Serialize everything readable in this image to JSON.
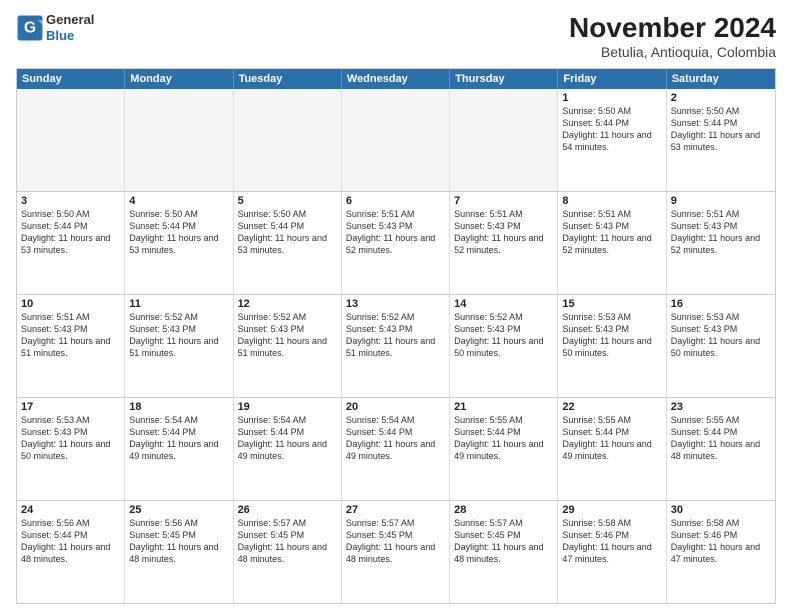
{
  "logo": {
    "general": "General",
    "blue": "Blue"
  },
  "title": "November 2024",
  "subtitle": "Betulia, Antioquia, Colombia",
  "weekdays": [
    "Sunday",
    "Monday",
    "Tuesday",
    "Wednesday",
    "Thursday",
    "Friday",
    "Saturday"
  ],
  "weeks": [
    [
      {
        "day": "",
        "empty": true
      },
      {
        "day": "",
        "empty": true
      },
      {
        "day": "",
        "empty": true
      },
      {
        "day": "",
        "empty": true
      },
      {
        "day": "",
        "empty": true
      },
      {
        "day": "1",
        "sunrise": "5:50 AM",
        "sunset": "5:44 PM",
        "daylight": "11 hours and 54 minutes."
      },
      {
        "day": "2",
        "sunrise": "5:50 AM",
        "sunset": "5:44 PM",
        "daylight": "11 hours and 53 minutes."
      }
    ],
    [
      {
        "day": "3",
        "sunrise": "5:50 AM",
        "sunset": "5:44 PM",
        "daylight": "11 hours and 53 minutes."
      },
      {
        "day": "4",
        "sunrise": "5:50 AM",
        "sunset": "5:44 PM",
        "daylight": "11 hours and 53 minutes."
      },
      {
        "day": "5",
        "sunrise": "5:50 AM",
        "sunset": "5:44 PM",
        "daylight": "11 hours and 53 minutes."
      },
      {
        "day": "6",
        "sunrise": "5:51 AM",
        "sunset": "5:43 PM",
        "daylight": "11 hours and 52 minutes."
      },
      {
        "day": "7",
        "sunrise": "5:51 AM",
        "sunset": "5:43 PM",
        "daylight": "11 hours and 52 minutes."
      },
      {
        "day": "8",
        "sunrise": "5:51 AM",
        "sunset": "5:43 PM",
        "daylight": "11 hours and 52 minutes."
      },
      {
        "day": "9",
        "sunrise": "5:51 AM",
        "sunset": "5:43 PM",
        "daylight": "11 hours and 52 minutes."
      }
    ],
    [
      {
        "day": "10",
        "sunrise": "5:51 AM",
        "sunset": "5:43 PM",
        "daylight": "11 hours and 51 minutes."
      },
      {
        "day": "11",
        "sunrise": "5:52 AM",
        "sunset": "5:43 PM",
        "daylight": "11 hours and 51 minutes."
      },
      {
        "day": "12",
        "sunrise": "5:52 AM",
        "sunset": "5:43 PM",
        "daylight": "11 hours and 51 minutes."
      },
      {
        "day": "13",
        "sunrise": "5:52 AM",
        "sunset": "5:43 PM",
        "daylight": "11 hours and 51 minutes."
      },
      {
        "day": "14",
        "sunrise": "5:52 AM",
        "sunset": "5:43 PM",
        "daylight": "11 hours and 50 minutes."
      },
      {
        "day": "15",
        "sunrise": "5:53 AM",
        "sunset": "5:43 PM",
        "daylight": "11 hours and 50 minutes."
      },
      {
        "day": "16",
        "sunrise": "5:53 AM",
        "sunset": "5:43 PM",
        "daylight": "11 hours and 50 minutes."
      }
    ],
    [
      {
        "day": "17",
        "sunrise": "5:53 AM",
        "sunset": "5:43 PM",
        "daylight": "11 hours and 50 minutes."
      },
      {
        "day": "18",
        "sunrise": "5:54 AM",
        "sunset": "5:44 PM",
        "daylight": "11 hours and 49 minutes."
      },
      {
        "day": "19",
        "sunrise": "5:54 AM",
        "sunset": "5:44 PM",
        "daylight": "11 hours and 49 minutes."
      },
      {
        "day": "20",
        "sunrise": "5:54 AM",
        "sunset": "5:44 PM",
        "daylight": "11 hours and 49 minutes."
      },
      {
        "day": "21",
        "sunrise": "5:55 AM",
        "sunset": "5:44 PM",
        "daylight": "11 hours and 49 minutes."
      },
      {
        "day": "22",
        "sunrise": "5:55 AM",
        "sunset": "5:44 PM",
        "daylight": "11 hours and 49 minutes."
      },
      {
        "day": "23",
        "sunrise": "5:55 AM",
        "sunset": "5:44 PM",
        "daylight": "11 hours and 48 minutes."
      }
    ],
    [
      {
        "day": "24",
        "sunrise": "5:56 AM",
        "sunset": "5:44 PM",
        "daylight": "11 hours and 48 minutes."
      },
      {
        "day": "25",
        "sunrise": "5:56 AM",
        "sunset": "5:45 PM",
        "daylight": "11 hours and 48 minutes."
      },
      {
        "day": "26",
        "sunrise": "5:57 AM",
        "sunset": "5:45 PM",
        "daylight": "11 hours and 48 minutes."
      },
      {
        "day": "27",
        "sunrise": "5:57 AM",
        "sunset": "5:45 PM",
        "daylight": "11 hours and 48 minutes."
      },
      {
        "day": "28",
        "sunrise": "5:57 AM",
        "sunset": "5:45 PM",
        "daylight": "11 hours and 48 minutes."
      },
      {
        "day": "29",
        "sunrise": "5:58 AM",
        "sunset": "5:46 PM",
        "daylight": "11 hours and 47 minutes."
      },
      {
        "day": "30",
        "sunrise": "5:58 AM",
        "sunset": "5:46 PM",
        "daylight": "11 hours and 47 minutes."
      }
    ]
  ]
}
